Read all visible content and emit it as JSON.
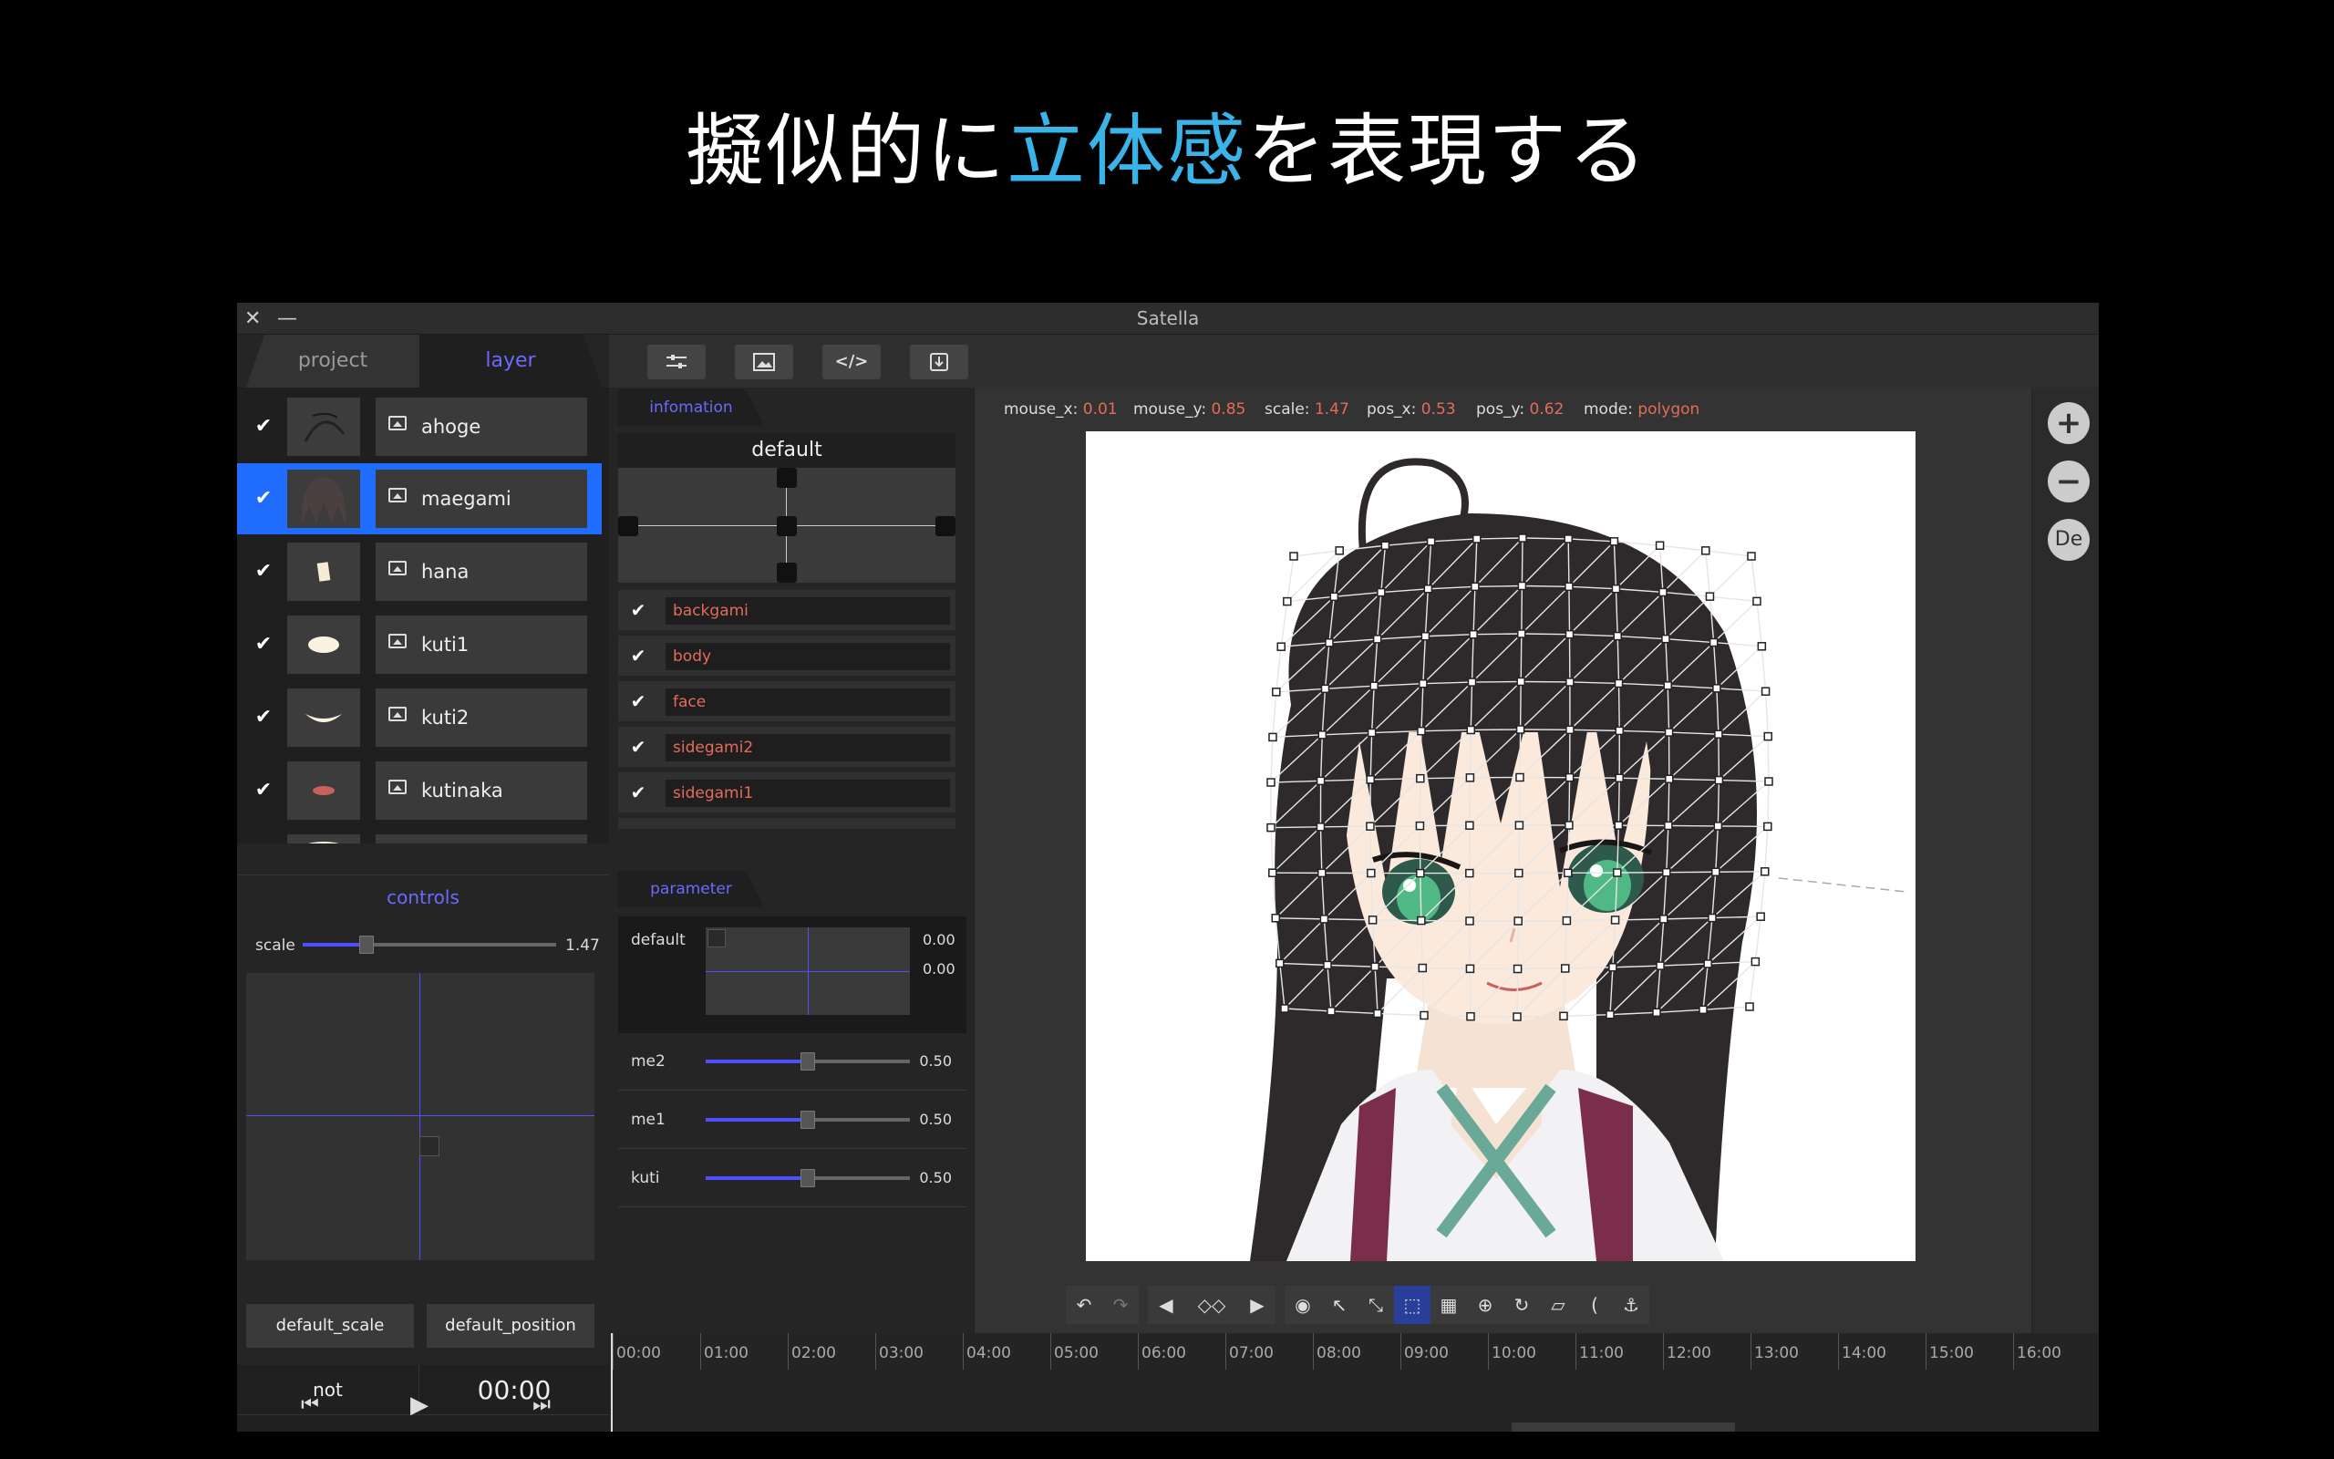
{
  "slide": {
    "title_part1": "擬似的に",
    "title_highlight": "立体感",
    "title_part2": "を表現する",
    "highlight_color": "#39b3e8"
  },
  "window": {
    "title": "Satella",
    "close_glyph": "✕",
    "minimize_glyph": "—"
  },
  "left_tabs": {
    "project": "project",
    "layer": "layer"
  },
  "layers": [
    {
      "name": "ahoge",
      "checked": true
    },
    {
      "name": "maegami",
      "checked": true,
      "selected": true
    },
    {
      "name": "hana",
      "checked": true
    },
    {
      "name": "kuti1",
      "checked": true
    },
    {
      "name": "kuti2",
      "checked": true
    },
    {
      "name": "kutinaka",
      "checked": true
    }
  ],
  "controls": {
    "header": "controls",
    "scale_label": "scale",
    "scale_value": "1.47",
    "default_scale": "default_scale",
    "default_position": "default_position"
  },
  "transport": {
    "state": "not",
    "time": "00:00",
    "prev_icon": "skip-back-icon",
    "play_icon": "play-icon",
    "next_icon": "skip-forward-icon"
  },
  "toolbar": {
    "buttons": [
      "sliders-icon",
      "image-icon",
      "code-icon",
      "download-icon"
    ],
    "code_label": "</>"
  },
  "info": {
    "tab": "infomation",
    "default_label": "default",
    "parts": [
      "backgami",
      "body",
      "face",
      "sidegami2",
      "sidegami1"
    ]
  },
  "parameter": {
    "tab": "parameter",
    "default_label": "default",
    "default_x": "0.00",
    "default_y": "0.00",
    "rows": [
      {
        "name": "me2",
        "value": "0.50"
      },
      {
        "name": "me1",
        "value": "0.50"
      },
      {
        "name": "kuti",
        "value": "0.50"
      }
    ]
  },
  "status": {
    "mouse_x_label": "mouse_x:",
    "mouse_x": "0.01",
    "mouse_y_label": "mouse_y:",
    "mouse_y": "0.85",
    "scale_label": "scale:",
    "scale": "1.47",
    "pos_x_label": "pos_x:",
    "pos_x": "0.53",
    "pos_y_label": "pos_y:",
    "pos_y": "0.62",
    "mode_label": "mode:",
    "mode": "polygon"
  },
  "zoom": {
    "plus": "+",
    "minus": "−",
    "default": "De"
  },
  "timeline": {
    "labels": [
      "00:00",
      "01:00",
      "02:00",
      "03:00",
      "04:00",
      "05:00",
      "06:00",
      "07:00",
      "08:00",
      "09:00",
      "10:00",
      "11:00",
      "12:00",
      "13:00",
      "14:00",
      "15:00",
      "16:00"
    ]
  },
  "colors": {
    "accent": "#6a6aff",
    "selection": "#1f6cff",
    "value": "#e56b5a"
  }
}
